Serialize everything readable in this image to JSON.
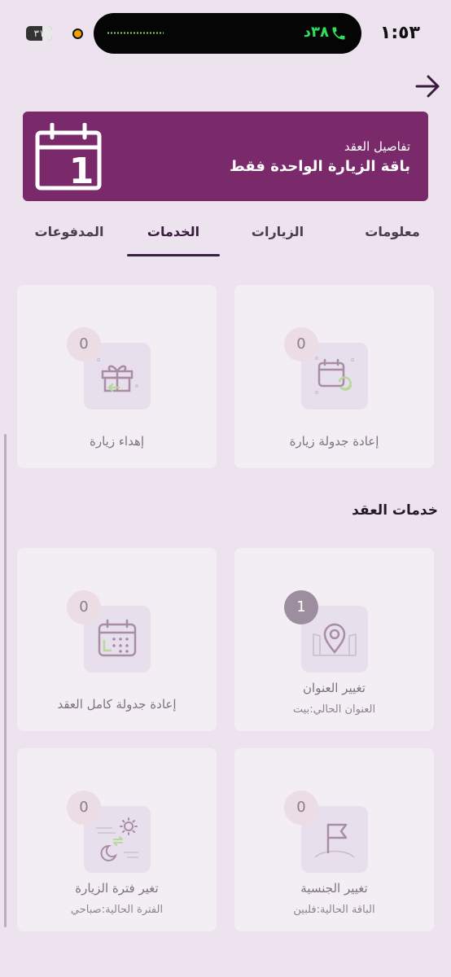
{
  "status_bar": {
    "time": "١:٥٣",
    "call_timer": "٣٨د",
    "battery": "٣١",
    "call_icon": "phone-icon"
  },
  "header": {
    "back_icon": "arrow-right-icon"
  },
  "contract": {
    "caption": "تفاصيل العقد",
    "title": "باقة الزيارة الواحدة فقط",
    "calendar_number": "1",
    "color": "#7A2A6B"
  },
  "tabs": [
    {
      "label": "معلومات"
    },
    {
      "label": "الزيارات"
    },
    {
      "label": "الخدمات",
      "active": true
    },
    {
      "label": "المدفوعات"
    }
  ],
  "visit_services": [
    {
      "label": "إعادة جدولة زيارة",
      "count": "0",
      "icon": "calendar-refresh-icon"
    },
    {
      "label": "إهداء زيارة",
      "count": "0",
      "icon": "gift-icon"
    }
  ],
  "contract_services_title": "خدمات العقد",
  "contract_services": [
    {
      "label": "تغيير العنوان",
      "sub": "العنوان الحالي:بيت",
      "count": "1",
      "icon": "location-pin-icon"
    },
    {
      "label": "إعادة جدولة كامل العقد",
      "count": "0",
      "icon": "calendar-grid-icon"
    },
    {
      "label": "تغيير الجنسية",
      "sub": "الباقة الحالية:فلبين",
      "count": "0",
      "icon": "flag-icon"
    },
    {
      "label": "تغير فترة الزيارة",
      "sub": "الفترة الحالية:صباحي",
      "count": "0",
      "icon": "day-night-icon"
    }
  ]
}
